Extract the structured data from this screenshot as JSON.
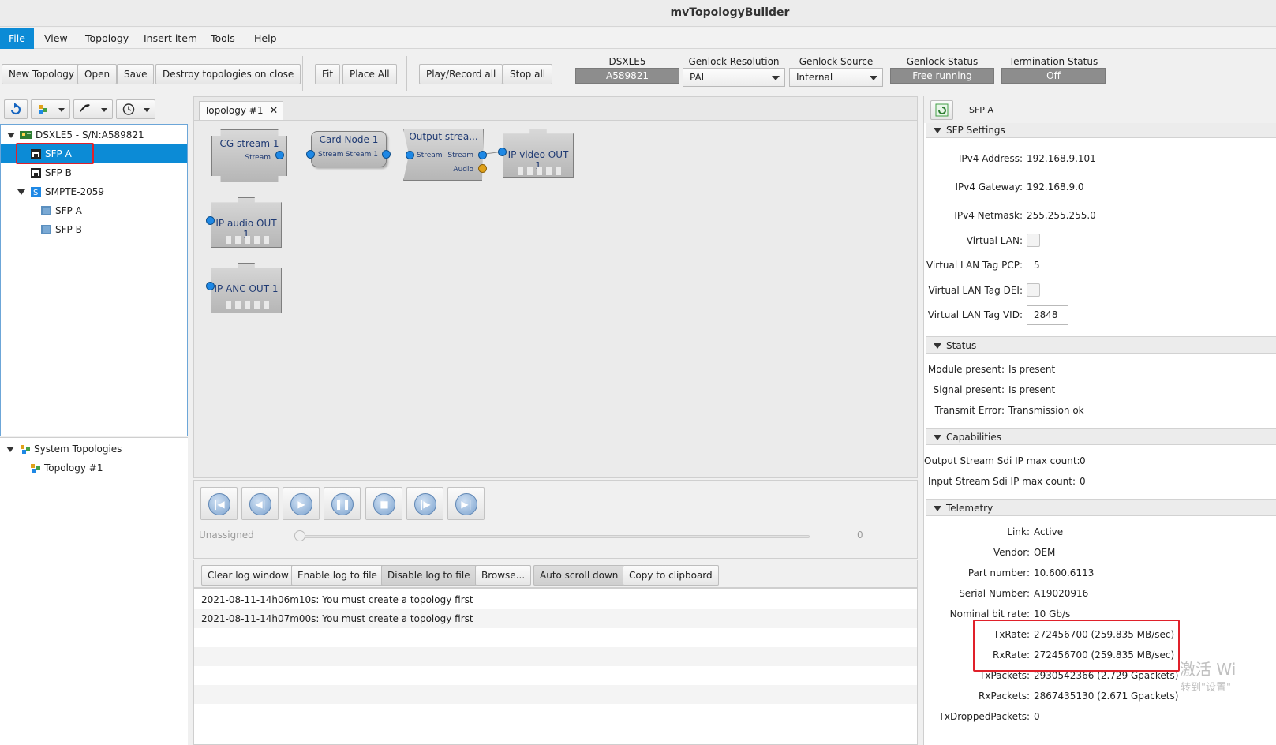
{
  "window": {
    "title": "mvTopologyBuilder"
  },
  "menu": [
    {
      "label": "File",
      "active": true
    },
    {
      "label": "View"
    },
    {
      "label": "Topology"
    },
    {
      "label": "Insert item"
    },
    {
      "label": "Tools"
    },
    {
      "label": "Help"
    }
  ],
  "toolbar": {
    "new_topology": "New Topology",
    "open": "Open",
    "save": "Save",
    "destroy": "Destroy topologies on close",
    "fit": "Fit",
    "place_all": "Place All",
    "play_record_all": "Play/Record all",
    "stop_all": "Stop all",
    "device_label": "DSXLE5",
    "device_serial": "A589821",
    "genlock_resolution_label": "Genlock Resolution",
    "genlock_resolution_value": "PAL",
    "genlock_source_label": "Genlock Source",
    "genlock_source_value": "Internal",
    "genlock_status_label": "Genlock Status",
    "genlock_status_value": "Free running",
    "termination_status_label": "Termination Status",
    "termination_status_value": "Off"
  },
  "device_tree": {
    "root": "DSXLE5 - S/N:A589821",
    "sfp_a": "SFP A",
    "sfp_b": "SFP B",
    "smpte": "SMPTE-2059",
    "smpte_sfp_a": "SFP A",
    "smpte_sfp_b": "SFP B"
  },
  "system_tree": {
    "root": "System Topologies",
    "child": "Topology #1"
  },
  "center": {
    "tab_label": "Topology #1",
    "nodes": {
      "cg_stream": "CG stream 1",
      "cg_port": "Stream",
      "card_node": "Card Node 1",
      "card_in": "Stream",
      "card_out": "Stream 1",
      "output_stream": "Output strea...",
      "out_in": "Stream",
      "out_stream": "Stream",
      "out_audio": "Audio",
      "ip_video": "IP video OUT 1",
      "ip_audio": "IP audio OUT 1",
      "ip_anc": "IP ANC OUT 1"
    },
    "player": {
      "unassigned": "Unassigned",
      "position": "0"
    },
    "log_buttons": {
      "clear": "Clear log window",
      "enable": "Enable log to file",
      "disable": "Disable log to file",
      "browse": "Browse...",
      "auto_scroll": "Auto scroll down",
      "copy": "Copy to clipboard"
    },
    "log": [
      "2021-08-11-14h06m10s: You must create a topology first",
      "2021-08-11-14h07m00s: You must create a topology first"
    ]
  },
  "properties": {
    "header": "SFP A",
    "sfp_settings": {
      "title": "SFP Settings",
      "ipv4_address_label": "IPv4 Address:",
      "ipv4_address": "192.168.9.101",
      "ipv4_gateway_label": "IPv4 Gateway:",
      "ipv4_gateway": "192.168.9.0",
      "ipv4_netmask_label": "IPv4 Netmask:",
      "ipv4_netmask": "255.255.255.0",
      "vlan_label": "Virtual LAN:",
      "vlan_pcp_label": "Virtual LAN Tag PCP:",
      "vlan_pcp": "5",
      "vlan_dei_label": "Virtual LAN Tag DEI:",
      "vlan_vid_label": "Virtual LAN Tag VID:",
      "vlan_vid": "2848"
    },
    "status": {
      "title": "Status",
      "module_label": "Module present:",
      "module": "Is present",
      "signal_label": "Signal present:",
      "signal": "Is present",
      "transmit_label": "Transmit Error:",
      "transmit": "Transmission ok"
    },
    "capabilities": {
      "title": "Capabilities",
      "out_label": "Output Stream Sdi IP max count:",
      "out": "0",
      "in_label": "Input Stream Sdi IP max count:",
      "in": "0"
    },
    "telemetry": {
      "title": "Telemetry",
      "link_label": "Link:",
      "link": "Active",
      "vendor_label": "Vendor:",
      "vendor": "OEM",
      "part_label": "Part number:",
      "part": "10.600.6113",
      "serial_label": "Serial Number:",
      "serial": "A19020916",
      "bitrate_label": "Nominal bit rate:",
      "bitrate": "10 Gb/s",
      "txrate_label": "TxRate:",
      "txrate": "272456700 (259.835 MB/sec)",
      "rxrate_label": "RxRate:",
      "rxrate": "272456700 (259.835 MB/sec)",
      "txpackets_label": "TxPackets:",
      "txpackets": "2930542366 (2.729 Gpackets)",
      "rxpackets_label": "RxPackets:",
      "rxpackets": "2867435130 (2.671 Gpackets)",
      "txdropped_label": "TxDroppedPackets:",
      "txdropped": "0"
    }
  },
  "watermark": {
    "line1": "激活 Wi",
    "line2": "转到\"设置\""
  },
  "colors": {
    "accent": "#0c8bd6",
    "highlight": "#e0202a"
  }
}
